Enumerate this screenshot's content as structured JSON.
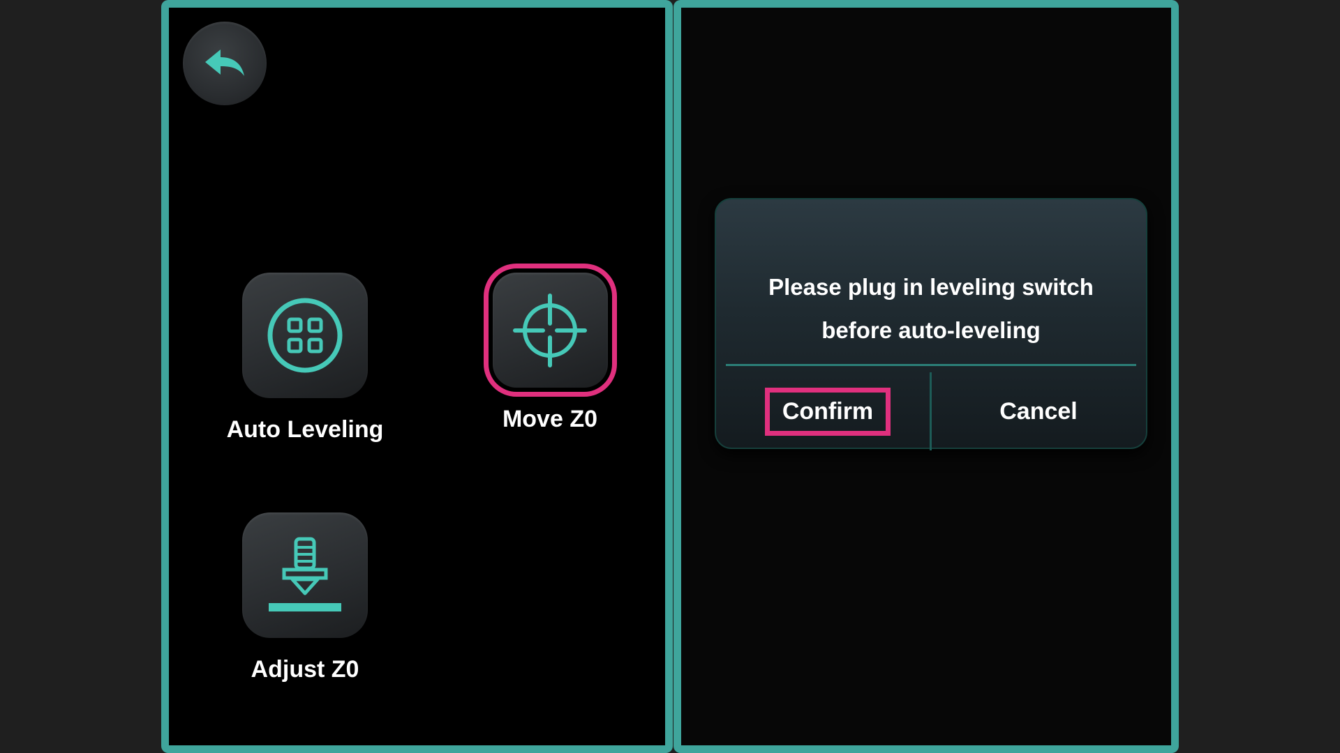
{
  "left_screen": {
    "tiles": [
      {
        "label": "Auto Leveling",
        "icon": "auto-leveling-grid-icon"
      },
      {
        "label": "Move Z0",
        "icon": "crosshair-target-icon",
        "highlighted": true
      },
      {
        "label": "Adjust Z0",
        "icon": "nozzle-bed-icon"
      }
    ],
    "back_icon": "back-arrow-icon"
  },
  "dialog": {
    "message_line1": "Please plug in leveling switch",
    "message_line2": "before auto-leveling",
    "confirm_label": "Confirm",
    "cancel_label": "Cancel"
  },
  "colors": {
    "accent": "#46c9b8",
    "frame": "#3fa59c",
    "highlight": "#e0307e",
    "background": "#000000"
  }
}
